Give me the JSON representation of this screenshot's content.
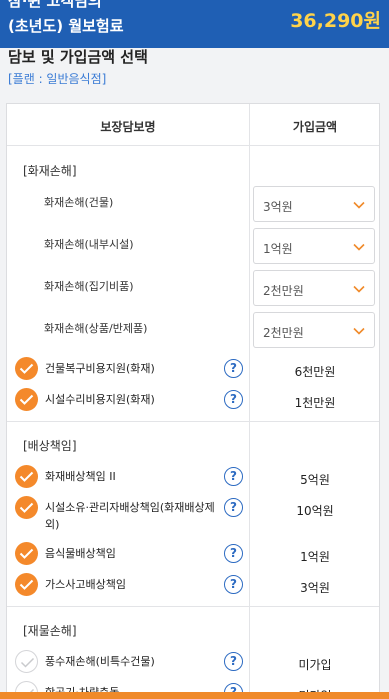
{
  "banner": {
    "line1": "참·쉰 고객님의",
    "line2": "(초년도) 월보험료",
    "price": "36,290원"
  },
  "section": {
    "title": "담보 및 가입금액 선택",
    "plan": "[플랜 : 일반음식점]"
  },
  "table": {
    "header_name": "보장담보명",
    "header_amount": "가입금액"
  },
  "groups": [
    {
      "label": "[화재손해]"
    },
    {
      "label": "[배상책임]"
    },
    {
      "label": "[재물손해]"
    }
  ],
  "select_rows": [
    {
      "name": "화재손해(건물)",
      "value": "3억원"
    },
    {
      "name": "화재손해(내부시설)",
      "value": "1억원"
    },
    {
      "name": "화재손해(집기비품)",
      "value": "2천만원"
    },
    {
      "name": "화재손해(상품/반제품)",
      "value": "2천만원"
    }
  ],
  "check_rows": [
    {
      "name": "건물복구비용지원(화재)",
      "amount": "6천만원",
      "checked": true
    },
    {
      "name": "시설수리비용지원(화재)",
      "amount": "1천만원",
      "checked": true
    },
    {
      "name": "화재배상책임 II",
      "amount": "5억원",
      "checked": true
    },
    {
      "name": "시설소유·관리자배상책임(화재배상제외)",
      "amount": "10억원",
      "checked": true
    },
    {
      "name": "음식물배상책임",
      "amount": "1억원",
      "checked": true
    },
    {
      "name": "가스사고배상책임",
      "amount": "3억원",
      "checked": true
    },
    {
      "name": "풍수재손해(비특수건물)",
      "amount": "미가입",
      "checked": false
    },
    {
      "name": "항공기·차량충돌",
      "amount": "미가입",
      "checked": false
    }
  ],
  "help_glyph": "?",
  "colors": {
    "banner": "#1f5fb4",
    "price": "#ffd34a",
    "accent": "#f4892b",
    "link": "#2d6bc2"
  }
}
